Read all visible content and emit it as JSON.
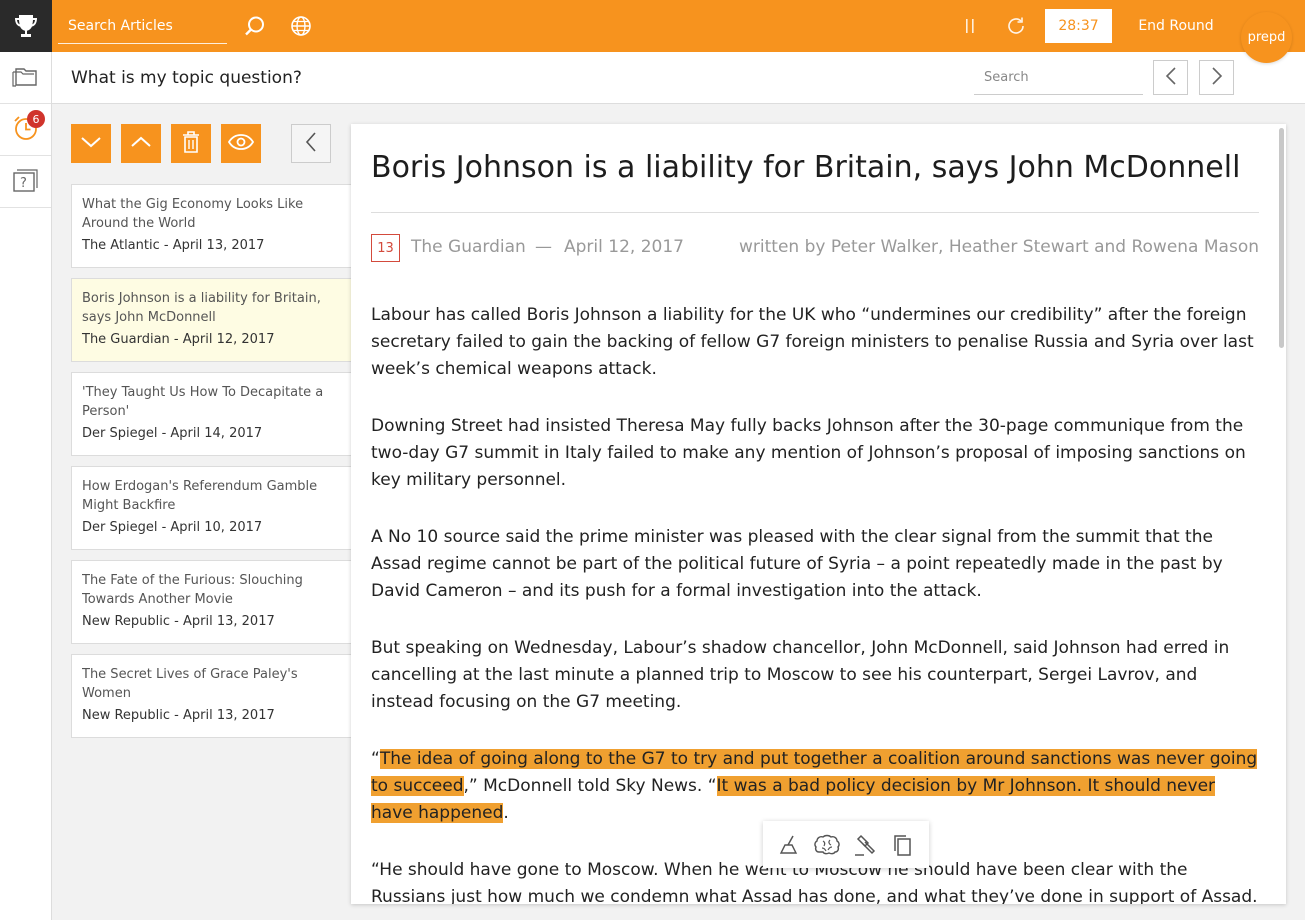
{
  "topbar": {
    "search_placeholder": "Search Articles",
    "timer": "28:37",
    "end_round_label": "End Round",
    "brand": "prepd"
  },
  "rail": {
    "alarm_badge": "6"
  },
  "question_bar": {
    "title": "What is my topic question?",
    "search_placeholder": "Search"
  },
  "articles": [
    {
      "title": "What the Gig Economy Looks Like Around the World",
      "meta": "The Atlantic - April 13, 2017"
    },
    {
      "title": "Boris Johnson is a liability for Britain, says John McDonnell",
      "meta": "The Guardian - April 12, 2017"
    },
    {
      "title": "'They Taught Us How To Decapitate a Person'",
      "meta": "Der Spiegel - April 14, 2017"
    },
    {
      "title": "How Erdogan's Referendum Gamble Might Backfire",
      "meta": "Der Spiegel - April 10, 2017"
    },
    {
      "title": "The Fate of the Furious: Slouching Towards Another Movie",
      "meta": "New Republic - April 13, 2017"
    },
    {
      "title": "The Secret Lives of Grace Paley's Women",
      "meta": "New Republic - April 13, 2017"
    }
  ],
  "article": {
    "title": "Boris Johnson is a liability for Britain, says John McDonnell",
    "score": "13",
    "source": "The Guardian",
    "separator": "—",
    "date": "April 12, 2017",
    "byline": "written by Peter Walker, Heather Stewart and Rowena Mason",
    "p1": "Labour has called Boris Johnson a liability for the UK who “undermines our credibility” after the foreign secretary failed to gain the backing of fellow G7 foreign ministers to penalise Russia and Syria over last week’s chemical weapons attack.",
    "p2": "Downing Street had insisted Theresa May fully backs Johnson after the 30-page communique from the two-day G7 summit in Italy failed to make any mention of Johnson’s proposal of imposing sanctions on key military personnel.",
    "p3": "A No 10 source said the prime minister was pleased with the clear signal from the summit that the Assad regime cannot be part of the political future of Syria – a point repeatedly made in the past by David Cameron – and its push for a formal investigation into the attack.",
    "p4": "But speaking on Wednesday, Labour’s shadow chancellor, John McDonnell, said Johnson had erred in cancelling at the last minute a planned trip to Moscow to see his counterpart, Sergei Lavrov, and instead focusing on the G7 meeting.",
    "p5_open": "“",
    "p5_hl1": "The idea of going along to the G7 to try and put together a coalition around sanctions was never going to succeed",
    "p5_mid": ",” McDonnell told Sky News. “",
    "p5_hl2": "It was a bad policy decision by Mr Johnson. It should never have happened",
    "p5_end": ".",
    "p6": "“He should have gone to Moscow. When he went to Moscow he should have been clear with the Russians just how much we condemn what Assad has done, and what they’ve done in support of Assad."
  },
  "colors": {
    "accent": "#f7931e",
    "highlight": "#f0a030",
    "score_red": "#d34a3c"
  }
}
